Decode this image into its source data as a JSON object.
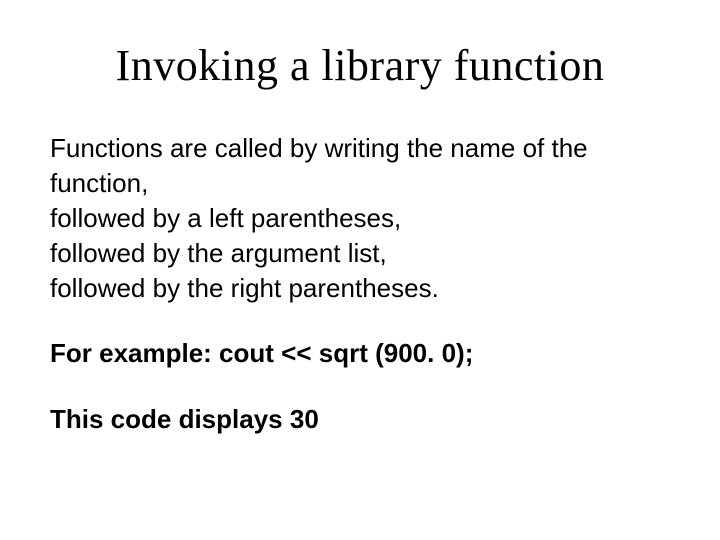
{
  "title": "Invoking a library function",
  "body": {
    "line1": "Functions are called by writing the name of the function,",
    "line2": "followed by a left parentheses,",
    "line3": "followed by the argument list,",
    "line4": "followed by the right parentheses."
  },
  "example": "For example:  cout << sqrt (900. 0);",
  "result": "This code displays 30"
}
